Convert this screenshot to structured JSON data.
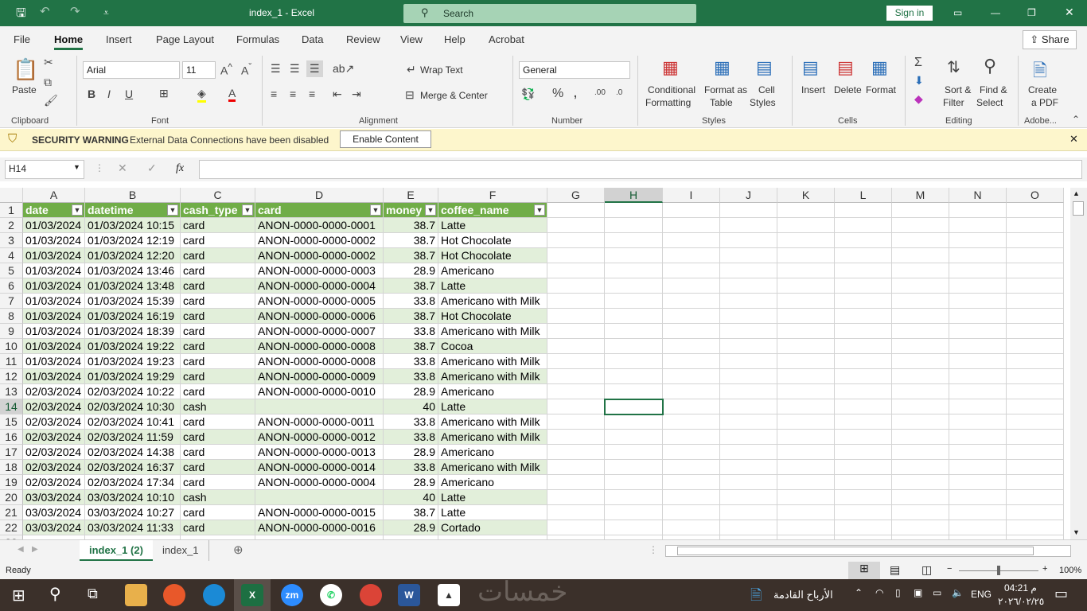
{
  "title": {
    "doc": "index_1  -  Excel",
    "search": "Search",
    "signin": "Sign in"
  },
  "menu": [
    "File",
    "Home",
    "Insert",
    "Page Layout",
    "Formulas",
    "Data",
    "Review",
    "View",
    "Help",
    "Acrobat"
  ],
  "share": "Share",
  "ribbon": {
    "paste": "Paste",
    "clipboard": "Clipboard",
    "font_name": "Arial",
    "font_size": "11",
    "font": "Font",
    "wrap": "Wrap Text",
    "merge": "Merge & Center",
    "alignment": "Alignment",
    "numfmt": "General",
    "number": "Number",
    "cond": "Conditional",
    "cond2": "Formatting",
    "fmt_table": "Format as",
    "fmt_table2": "Table",
    "cell_styles": "Cell",
    "cell_styles2": "Styles",
    "styles": "Styles",
    "insert": "Insert",
    "delete": "Delete",
    "format": "Format",
    "cells": "Cells",
    "sort": "Sort &",
    "sort2": "Filter",
    "find": "Find &",
    "find2": "Select",
    "editing": "Editing",
    "pdf": "Create",
    "pdf2": "a PDF",
    "adobe": "Adobe..."
  },
  "security": {
    "label": "SECURITY WARNING",
    "message": "External Data Connections have been disabled",
    "button": "Enable Content"
  },
  "formula": {
    "namebox": "H14",
    "fx": "fx",
    "value": ""
  },
  "columns": [
    "A",
    "B",
    "C",
    "D",
    "E",
    "F",
    "G",
    "H",
    "I",
    "J",
    "K",
    "L",
    "M",
    "N",
    "O"
  ],
  "selected_cell": "H14",
  "table": {
    "headers": [
      "date",
      "datetime",
      "cash_type",
      "card",
      "money",
      "coffee_name"
    ],
    "rows": [
      [
        "01/03/2024",
        "01/03/2024 10:15",
        "card",
        "ANON-0000-0000-0001",
        "38.7",
        "Latte"
      ],
      [
        "01/03/2024",
        "01/03/2024 12:19",
        "card",
        "ANON-0000-0000-0002",
        "38.7",
        "Hot Chocolate"
      ],
      [
        "01/03/2024",
        "01/03/2024 12:20",
        "card",
        "ANON-0000-0000-0002",
        "38.7",
        "Hot Chocolate"
      ],
      [
        "01/03/2024",
        "01/03/2024 13:46",
        "card",
        "ANON-0000-0000-0003",
        "28.9",
        "Americano"
      ],
      [
        "01/03/2024",
        "01/03/2024 13:48",
        "card",
        "ANON-0000-0000-0004",
        "38.7",
        "Latte"
      ],
      [
        "01/03/2024",
        "01/03/2024 15:39",
        "card",
        "ANON-0000-0000-0005",
        "33.8",
        "Americano with Milk"
      ],
      [
        "01/03/2024",
        "01/03/2024 16:19",
        "card",
        "ANON-0000-0000-0006",
        "38.7",
        "Hot Chocolate"
      ],
      [
        "01/03/2024",
        "01/03/2024 18:39",
        "card",
        "ANON-0000-0000-0007",
        "33.8",
        "Americano with Milk"
      ],
      [
        "01/03/2024",
        "01/03/2024 19:22",
        "card",
        "ANON-0000-0000-0008",
        "38.7",
        "Cocoa"
      ],
      [
        "01/03/2024",
        "01/03/2024 19:23",
        "card",
        "ANON-0000-0000-0008",
        "33.8",
        "Americano with Milk"
      ],
      [
        "01/03/2024",
        "01/03/2024 19:29",
        "card",
        "ANON-0000-0000-0009",
        "33.8",
        "Americano with Milk"
      ],
      [
        "02/03/2024",
        "02/03/2024 10:22",
        "card",
        "ANON-0000-0000-0010",
        "28.9",
        "Americano"
      ],
      [
        "02/03/2024",
        "02/03/2024 10:30",
        "cash",
        "",
        "40",
        "Latte"
      ],
      [
        "02/03/2024",
        "02/03/2024 10:41",
        "card",
        "ANON-0000-0000-0011",
        "33.8",
        "Americano with Milk"
      ],
      [
        "02/03/2024",
        "02/03/2024 11:59",
        "card",
        "ANON-0000-0000-0012",
        "33.8",
        "Americano with Milk"
      ],
      [
        "02/03/2024",
        "02/03/2024 14:38",
        "card",
        "ANON-0000-0000-0013",
        "28.9",
        "Americano"
      ],
      [
        "02/03/2024",
        "02/03/2024 16:37",
        "card",
        "ANON-0000-0000-0014",
        "33.8",
        "Americano with Milk"
      ],
      [
        "02/03/2024",
        "02/03/2024 17:34",
        "card",
        "ANON-0000-0000-0004",
        "28.9",
        "Americano"
      ],
      [
        "03/03/2024",
        "03/03/2024 10:10",
        "cash",
        "",
        "40",
        "Latte"
      ],
      [
        "03/03/2024",
        "03/03/2024 10:27",
        "card",
        "ANON-0000-0000-0015",
        "38.7",
        "Latte"
      ],
      [
        "03/03/2024",
        "03/03/2024 11:33",
        "card",
        "ANON-0000-0000-0016",
        "28.9",
        "Cortado"
      ]
    ]
  },
  "sheets": [
    {
      "name": "index_1 (2)",
      "active": true
    },
    {
      "name": "index_1",
      "active": false
    }
  ],
  "status": {
    "ready": "Ready",
    "zoom": "100%",
    "zoom_level": 100
  },
  "taskbar": {
    "file_label": "الأرباح القادمة",
    "lang": "ENG",
    "time": "04:21 م",
    "date": "٢٠٢٦/٠٢/٢٥",
    "watermark": "خمسات"
  },
  "colors": {
    "excel_green": "#217346",
    "table_header": "#70ad47",
    "band": "#e2efda"
  }
}
